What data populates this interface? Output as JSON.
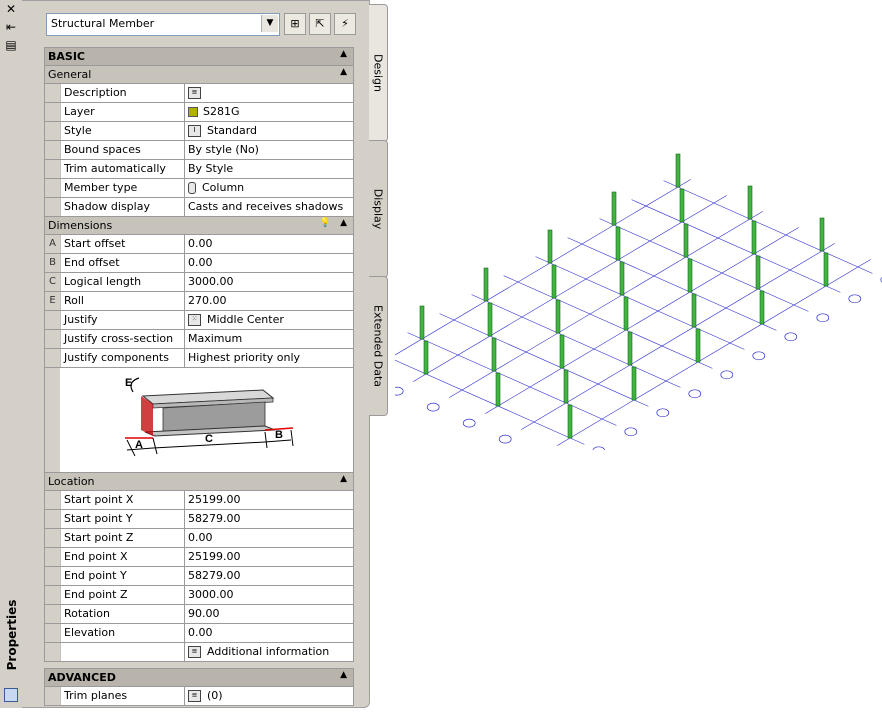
{
  "strip": {
    "title": "Properties"
  },
  "dropdown": {
    "value": "Structural Member"
  },
  "tabs": [
    "Design",
    "Display",
    "Extended Data"
  ],
  "sections": {
    "basic": "BASIC",
    "general": "General",
    "dimensions": "Dimensions",
    "location": "Location",
    "advanced": "ADVANCED"
  },
  "general_rows": [
    {
      "label": "Description",
      "value": ""
    },
    {
      "label": "Layer",
      "value": "S281G"
    },
    {
      "label": "Style",
      "value": "Standard"
    },
    {
      "label": "Bound spaces",
      "value": "By style (No)"
    },
    {
      "label": "Trim automatically",
      "value": "By Style"
    },
    {
      "label": "Member type",
      "value": "Column"
    },
    {
      "label": "Shadow display",
      "value": "Casts and receives shadows"
    }
  ],
  "dimension_rows": [
    {
      "letter": "A",
      "label": "Start offset",
      "value": "0.00"
    },
    {
      "letter": "B",
      "label": "End offset",
      "value": "0.00"
    },
    {
      "letter": "C",
      "label": "Logical length",
      "value": "3000.00"
    },
    {
      "letter": "E",
      "label": "Roll",
      "value": "270.00"
    },
    {
      "letter": "",
      "label": "Justify",
      "value": "Middle Center"
    },
    {
      "letter": "",
      "label": "Justify cross-section",
      "value": "Maximum"
    },
    {
      "letter": "",
      "label": "Justify components",
      "value": "Highest priority only"
    }
  ],
  "diagram_labels": {
    "a": "A",
    "b": "B",
    "c": "C",
    "e": "E"
  },
  "location_rows": [
    {
      "label": "Start point X",
      "value": "25199.00"
    },
    {
      "label": "Start point Y",
      "value": "58279.00"
    },
    {
      "label": "Start point Z",
      "value": "0.00"
    },
    {
      "label": "End point X",
      "value": "25199.00"
    },
    {
      "label": "End point Y",
      "value": "58279.00"
    },
    {
      "label": "End point Z",
      "value": "3000.00"
    },
    {
      "label": "Rotation",
      "value": "90.00"
    },
    {
      "label": "Elevation",
      "value": "0.00"
    },
    {
      "label": "",
      "value": "Additional information"
    }
  ],
  "advanced_rows": [
    {
      "label": "Trim planes",
      "value": "(0)"
    }
  ],
  "colors": {
    "layer_swatch": "#b0b000",
    "column_green": "#3fb23f",
    "grid_blue": "#3030d0"
  }
}
